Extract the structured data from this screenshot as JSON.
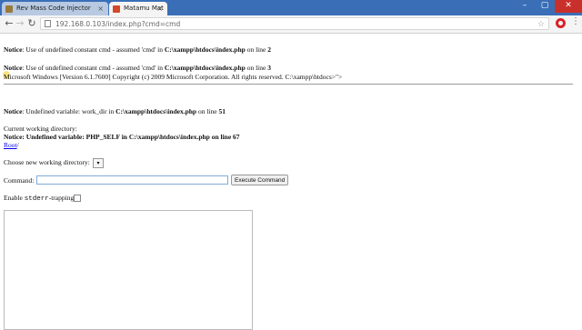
{
  "browser": {
    "tabs": [
      {
        "title": "Rev Mass Code Injector",
        "favicon_color": "#9a7a3a"
      },
      {
        "title": "Matamu Mat",
        "favicon_color": "#d24a2a"
      }
    ],
    "window_controls": {
      "minimize": "–",
      "maximize": "▢",
      "close": "✕"
    },
    "url": "192.168.0.103/index.php?cmd=cmd"
  },
  "page": {
    "notice1": {
      "label": "Notice",
      "text1": ": Use of undefined constant cmd - assumed 'cmd' in ",
      "file": "C:\\xampp\\htdocs\\index.php",
      "text2": " on line ",
      "line": "2"
    },
    "notice2": {
      "label": "Notice",
      "text1": ": Use of undefined constant cmd - assumed 'cmd' in ",
      "file": "C:\\xampp\\htdocs\\index.php",
      "text2": " on line ",
      "line": "3"
    },
    "windows_banner": "Microsoft Windows [Version 6.1.7600] Copyright (c) 2009 Microsoft Corporation. All rights reserved. C:\\xampp\\htdocs>\">",
    "notice3": {
      "label": "Notice",
      "text1": ": Undefined variable: work_dir in ",
      "file": "C:\\xampp\\htdocs\\index.php",
      "text2": " on line ",
      "line": "51"
    },
    "current_dir_label": "Current working directory:",
    "notice4": "Notice: Undefined variable: PHP_SELF in C:\\xampp\\htdocs\\index.php on line 67",
    "root_link": "Root",
    "root_suffix": "/",
    "choose_dir_label": "Choose new working directory:",
    "choose_dir_arrow": "▾",
    "command_label": "Command:",
    "command_value": "",
    "execute_button": "Execute Command",
    "enable_prefix": "Enable ",
    "enable_mono": "stderr",
    "enable_suffix": "-trapping?"
  }
}
